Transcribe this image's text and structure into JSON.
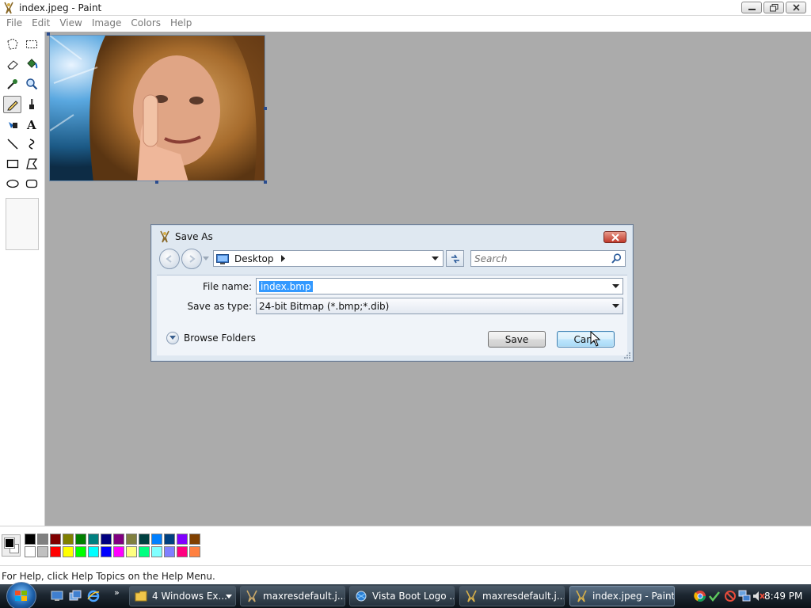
{
  "window": {
    "title": "index.jpeg - Paint",
    "buttons": [
      "minimize",
      "restore",
      "close"
    ]
  },
  "menu": [
    "File",
    "Edit",
    "View",
    "Image",
    "Colors",
    "Help"
  ],
  "toolbox": {
    "tools": [
      {
        "name": "free-form-select",
        "icon": "free-select-icon"
      },
      {
        "name": "select",
        "icon": "rect-select-icon"
      },
      {
        "name": "eraser",
        "icon": "eraser-icon"
      },
      {
        "name": "fill",
        "icon": "fill-bucket-icon"
      },
      {
        "name": "pick-color",
        "icon": "eyedropper-icon"
      },
      {
        "name": "magnifier",
        "icon": "magnifier-icon"
      },
      {
        "name": "pencil",
        "icon": "pencil-icon",
        "active": true
      },
      {
        "name": "brush",
        "icon": "brush-icon"
      },
      {
        "name": "airbrush",
        "icon": "airbrush-icon"
      },
      {
        "name": "text",
        "icon": "text-icon"
      },
      {
        "name": "line",
        "icon": "line-icon"
      },
      {
        "name": "curve",
        "icon": "curve-icon"
      },
      {
        "name": "rectangle",
        "icon": "rectangle-icon"
      },
      {
        "name": "polygon",
        "icon": "polygon-icon"
      },
      {
        "name": "ellipse",
        "icon": "ellipse-icon"
      },
      {
        "name": "rounded-rectangle",
        "icon": "rounded-rect-icon"
      }
    ]
  },
  "palette": {
    "foreground": "#000000",
    "background": "#ffffff",
    "top_row": [
      "#000000",
      "#808080",
      "#800000",
      "#808000",
      "#008000",
      "#008080",
      "#000080",
      "#800080",
      "#808040",
      "#004040",
      "#0080ff",
      "#004080",
      "#8000ff",
      "#804000"
    ],
    "bottom_row": [
      "#ffffff",
      "#c0c0c0",
      "#ff0000",
      "#ffff00",
      "#00ff00",
      "#00ffff",
      "#0000ff",
      "#ff00ff",
      "#ffff80",
      "#00ff80",
      "#80ffff",
      "#8080ff",
      "#ff0080",
      "#ff8040"
    ]
  },
  "status": {
    "text": "For Help, click Help Topics on the Help Menu."
  },
  "dialog": {
    "title": "Save As",
    "location": "Desktop",
    "search_placeholder": "Search",
    "file_name_label": "File name:",
    "file_name_value": "index.bmp",
    "save_as_type_label": "Save as type:",
    "save_as_type_value": "24-bit Bitmap (*.bmp;*.dib)",
    "browse_folders": "Browse Folders",
    "save_button": "Save",
    "cancel_button": "Canc"
  },
  "taskbar": {
    "buttons": [
      {
        "label": "4 Windows Ex...",
        "icon": "folder-icon",
        "has_dropdown": true
      },
      {
        "label": "maxresdefault.j...",
        "icon": "image-viewer-icon"
      },
      {
        "label": "Vista Boot Logo ...",
        "icon": "browser-icon"
      },
      {
        "label": "maxresdefault.j...",
        "icon": "paint-icon"
      },
      {
        "label": "index.jpeg - Paint",
        "icon": "paint-icon",
        "active": true
      }
    ],
    "clock": "8:49 PM"
  }
}
